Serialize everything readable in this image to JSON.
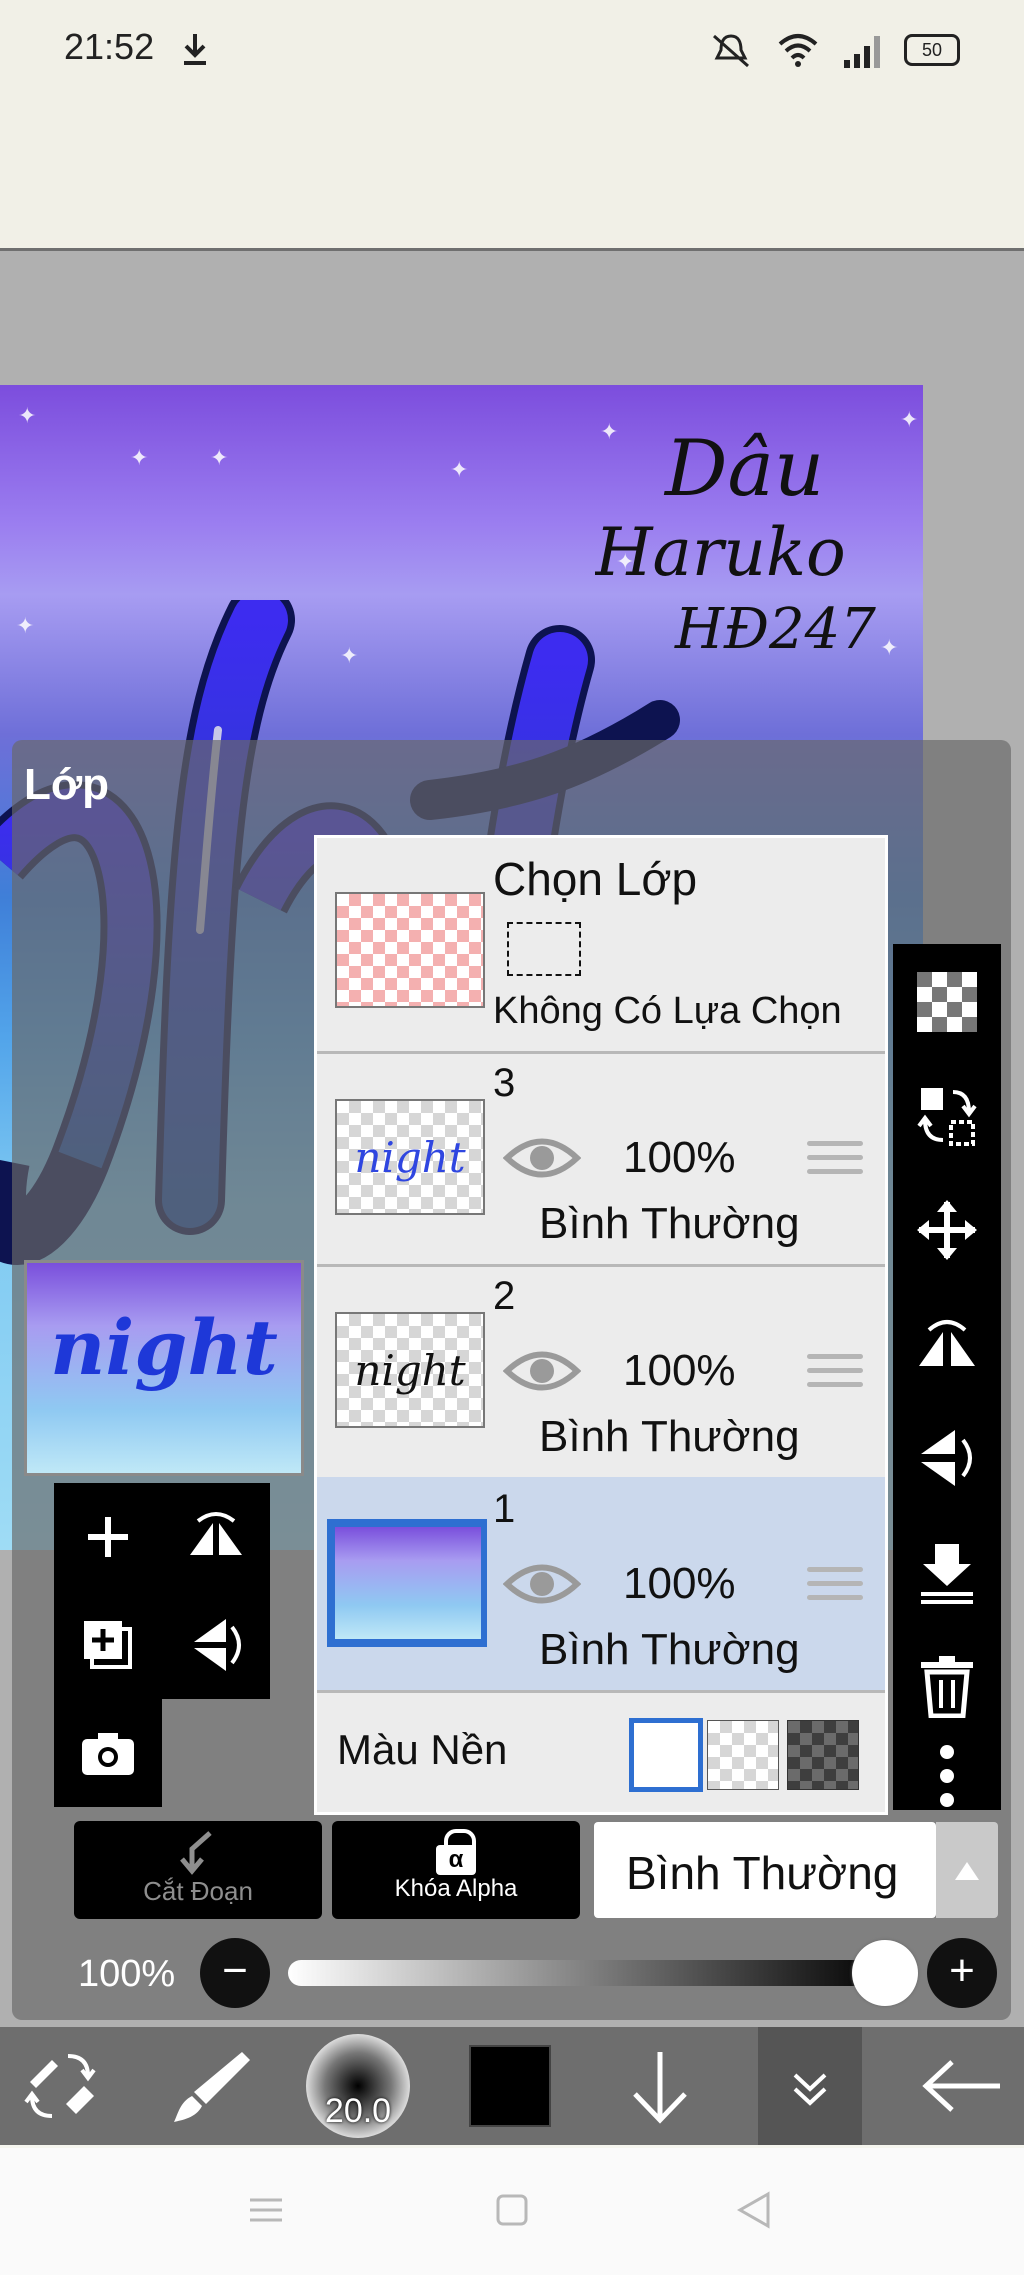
{
  "status_bar": {
    "time": "21:52",
    "battery": "50",
    "icons": [
      "download-icon",
      "mute-icon",
      "wifi-icon",
      "signal-icon",
      "battery-icon"
    ]
  },
  "canvas": {
    "artwork_text": "night",
    "signature_lines": [
      "Dâu",
      "Haruko",
      "HĐ247"
    ]
  },
  "layer_panel": {
    "title": "Lớp",
    "selection_row": {
      "title": "Chọn Lớp",
      "status": "Không Có Lựa Chọn"
    },
    "layers": [
      {
        "number": "3",
        "opacity": "100%",
        "blend": "Bình Thường",
        "thumb_text": "night",
        "thumb_color": "#2f46e0",
        "selected": false
      },
      {
        "number": "2",
        "opacity": "100%",
        "blend": "Bình Thường",
        "thumb_text": "night",
        "thumb_color": "#111111",
        "selected": false
      },
      {
        "number": "1",
        "opacity": "100%",
        "blend": "Bình Thường",
        "thumb_text": "",
        "thumb_color": "",
        "selected": true
      }
    ],
    "background_row": {
      "label": "Màu Nền",
      "options": [
        "white",
        "transparent",
        "dark-checker"
      ],
      "selected": "white"
    },
    "clipping_label": "Cắt Đoạn",
    "alpha_lock_label": "Khóa Alpha",
    "alpha_symbol": "α",
    "blend_mode": "Bình Thường",
    "opacity": {
      "label": "100%",
      "value": 100,
      "minus": "−",
      "plus": "+"
    }
  },
  "bottom_toolbar": {
    "brush_size": "20.0",
    "current_color": "#000000"
  },
  "colors": {
    "accent": "#2e6fd1",
    "selected_row": "#cbd8ec",
    "panel_black": "#000000"
  }
}
